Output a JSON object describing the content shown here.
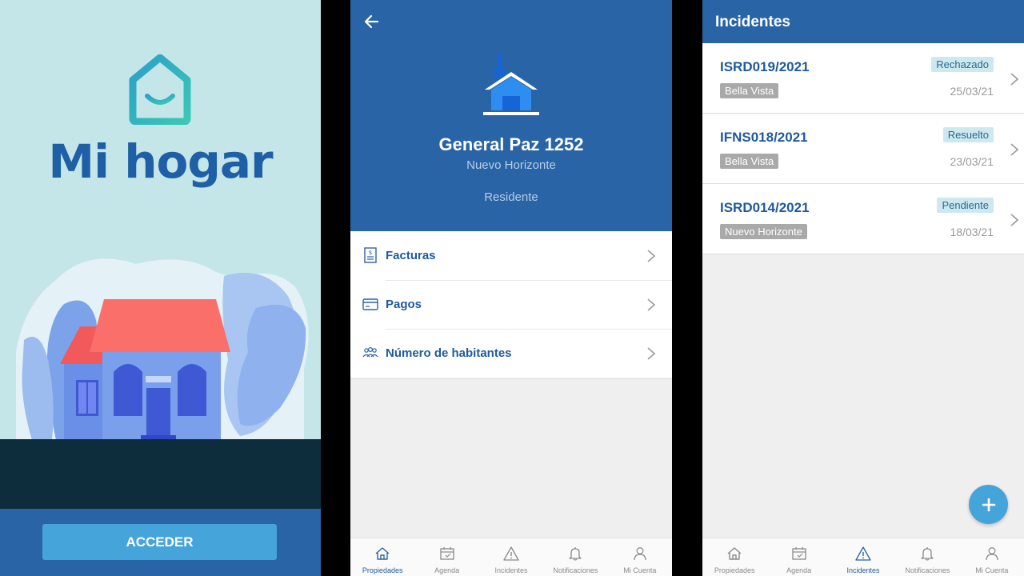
{
  "colors": {
    "primary": "#2964a6",
    "accent": "#45a4d9",
    "splash_bg": "#c5e6e8",
    "splash_dark": "#0d2c3c",
    "status_bg": "#cde8ef",
    "location_bg": "#a9a9a9"
  },
  "splash": {
    "app_name": "Mi hogar",
    "logo_icon": "smiling-house-icon",
    "button_label": "ACCEDER"
  },
  "property": {
    "back_icon": "arrow-left-icon",
    "house_icon": "house-icon",
    "name": "General Paz 1252",
    "neighborhood": "Nuevo Horizonte",
    "role": "Residente",
    "menu": [
      {
        "label": "Facturas",
        "icon": "invoice-icon"
      },
      {
        "label": "Pagos",
        "icon": "credit-card-icon"
      },
      {
        "label": "Número de habitantes",
        "icon": "people-icon"
      }
    ],
    "nav": [
      {
        "label": "Propiedades",
        "icon": "home-icon",
        "active": true
      },
      {
        "label": "Agenda",
        "icon": "calendar-icon",
        "active": false
      },
      {
        "label": "Incidentes",
        "icon": "warning-icon",
        "active": false
      },
      {
        "label": "Notificaciones",
        "icon": "bell-icon",
        "active": false
      },
      {
        "label": "Mi Cuenta",
        "icon": "user-icon",
        "active": false
      }
    ]
  },
  "incidents": {
    "title": "Incidentes",
    "fab_icon": "plus-icon",
    "items": [
      {
        "code": "ISRD019/2021",
        "location": "Bella Vista",
        "status": "Rechazado",
        "date": "25/03/21"
      },
      {
        "code": "IFNS018/2021",
        "location": "Bella Vista",
        "status": "Resuelto",
        "date": "23/03/21"
      },
      {
        "code": "ISRD014/2021",
        "location": "Nuevo Horizonte",
        "status": "Pendiente",
        "date": "18/03/21"
      }
    ],
    "nav": [
      {
        "label": "Propiedades",
        "icon": "home-icon",
        "active": false
      },
      {
        "label": "Agenda",
        "icon": "calendar-icon",
        "active": false
      },
      {
        "label": "Incidentes",
        "icon": "warning-icon",
        "active": true
      },
      {
        "label": "Notificaciones",
        "icon": "bell-icon",
        "active": false
      },
      {
        "label": "Mi Cuenta",
        "icon": "user-icon",
        "active": false
      }
    ]
  }
}
